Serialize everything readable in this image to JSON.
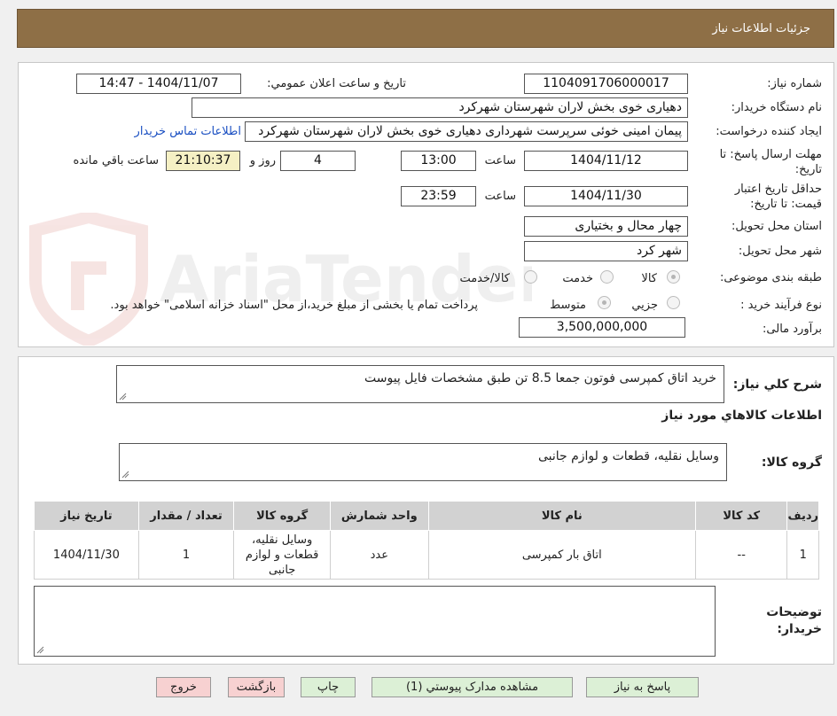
{
  "header": {
    "title": "جزئیات اطلاعات نیاز"
  },
  "details": {
    "need_number_label": "شماره نیاز:",
    "need_number": "1104091706000017",
    "announce_label": "تاریخ و ساعت اعلان عمومي:",
    "announce_value": "1404/11/07 - 14:47",
    "buyer_org_label": "نام دستگاه خریدار:",
    "buyer_org": "دهیاری خوی بخش لاران شهرستان شهرکرد",
    "requester_label": "ایجاد کننده درخواست:",
    "requester": "پیمان امینی خوئی سرپرست شهرداری دهیاری خوی بخش لاران شهرستان شهرکرد",
    "contact_link": "اطلاعات تماس خریدار",
    "deadline_label": "مهلت ارسال پاسخ: تا تاریخ:",
    "deadline_date": "1404/11/12",
    "time_label": "ساعت",
    "deadline_time": "13:00",
    "days_value": "4",
    "days_label": "روز و",
    "remaining_time": "21:10:37",
    "remaining_label": "ساعت باقي مانده",
    "validity_label": "حداقل تاريخ اعتبار قیمت: تا تاریخ:",
    "validity_date": "1404/11/30",
    "validity_time": "23:59",
    "province_label": "استان محل تحویل:",
    "province": "چهار محال و بختیاری",
    "city_label": "شهر محل تحویل:",
    "city": "شهر کرد",
    "category_label": "طبقه بندی موضوعی:",
    "category_options": [
      "کالا",
      "خدمت",
      "کالا/خدمت"
    ],
    "process_label": "نوع فرآیند خرید :",
    "process_options": [
      "جزیي",
      "متوسط"
    ],
    "process_note": "پرداخت تمام یا بخشی از مبلغ خرید،از محل \"اسناد خزانه اسلامی\" خواهد بود.",
    "budget_label": "برآورد مالی:",
    "budget": "3,500,000,000"
  },
  "description": {
    "label": "شرح کلي نیاز:",
    "text": "خرید اتاق کمپرسی فوتون جمعا 8.5 تن طبق مشخصات فایل پیوست",
    "goods_info_title": "اطلاعات کالاهاي مورد نیاز",
    "goods_group_label": "گروه کالا:",
    "goods_group": "وسایل نقلیه، قطعات و لوازم جانبی"
  },
  "table": {
    "headers": [
      "ردیف",
      "کد کالا",
      "نام کالا",
      "واحد شمارش",
      "گروه کالا",
      "تعداد / مقدار",
      "تاریخ نیاز"
    ],
    "rows": [
      {
        "row": "1",
        "code": "--",
        "name": "اتاق بار کمپرسی",
        "unit": "عدد",
        "group": "وسایل نقلیه، قطعات و لوازم جانبی",
        "qty": "1",
        "date": "1404/11/30"
      }
    ]
  },
  "notes": {
    "label": "توضیحات خریدار:",
    "text": ""
  },
  "buttons": {
    "reply": "پاسخ به نیاز",
    "attachments": "مشاهده مدارک پیوستي (1)",
    "print": "چاپ",
    "back": "بازگشت",
    "exit": "خروج"
  },
  "watermark": {
    "text": "AriaTender.neT"
  },
  "colors": {
    "header_bg": "#8e6f46",
    "link": "#1a4fc2",
    "button_green": "#dcf0d6",
    "button_pink": "#f7d1d1",
    "remaining_bg": "#f5f0c4"
  }
}
